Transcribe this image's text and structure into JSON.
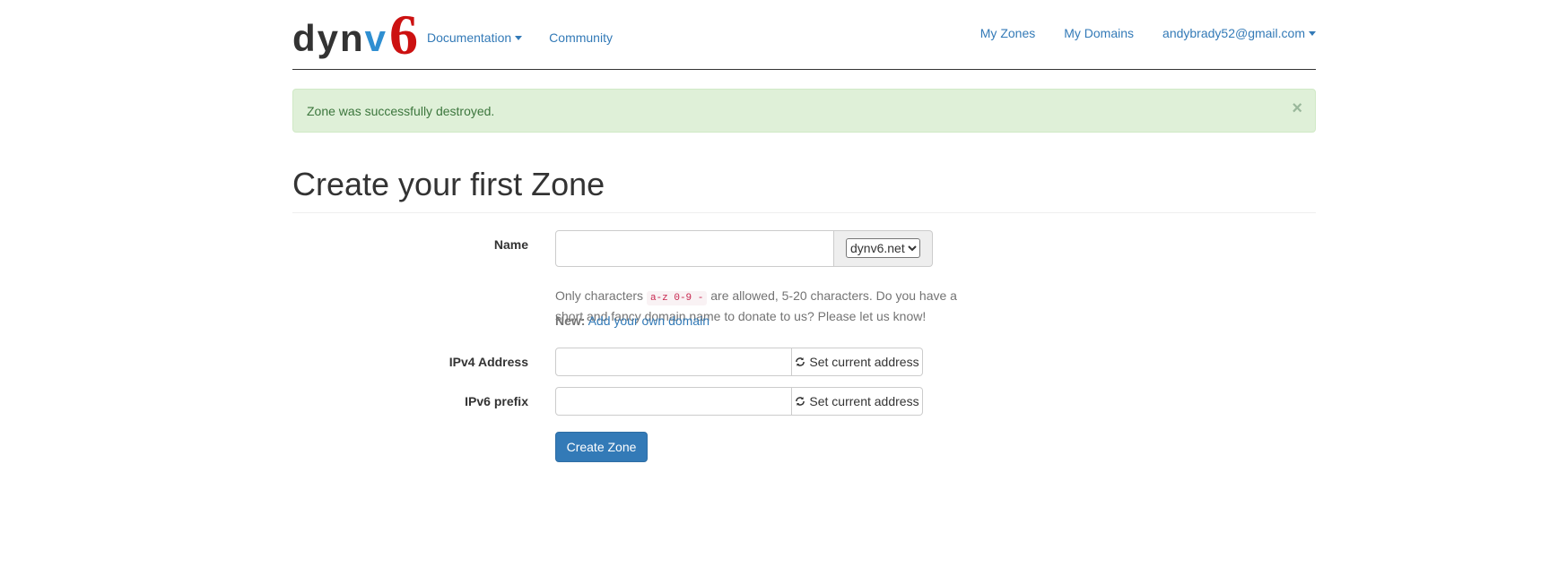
{
  "brand": {
    "text_main": "dyn",
    "text_v": "v",
    "text_6": "6"
  },
  "nav": {
    "documentation": "Documentation",
    "community": "Community",
    "my_zones": "My Zones",
    "my_domains": "My Domains",
    "user_email": "andybrady52@gmail.com"
  },
  "alert": {
    "message": "Zone was successfully destroyed.",
    "close": "×"
  },
  "page": {
    "title": "Create your first Zone"
  },
  "form": {
    "name_label": "Name",
    "name_value": "",
    "domain_selected": "dynv6.net",
    "help_before": "Only characters ",
    "help_code": "a-z 0-9 -",
    "help_after": " are allowed, 5-20 characters. Do you have a short and fancy domain name to donate to us? Please let us know!",
    "new_label": "New:",
    "add_domain_link": "Add your own domain",
    "ipv4_label": "IPv4 Address",
    "ipv4_value": "",
    "ipv4_button": "Set current address",
    "ipv6_label": "IPv6 prefix",
    "ipv6_value": "",
    "ipv6_button": "Set current address",
    "submit": "Create Zone"
  },
  "icons": {
    "refresh": "refresh-icon",
    "caret": "caret-down-icon",
    "close": "close-icon"
  },
  "colors": {
    "link": "#337ab7",
    "brand_v": "#2f8fd1",
    "brand_6": "#cc1111",
    "alert_bg": "#dff0d8",
    "alert_text": "#3c763d",
    "primary": "#337ab7"
  }
}
